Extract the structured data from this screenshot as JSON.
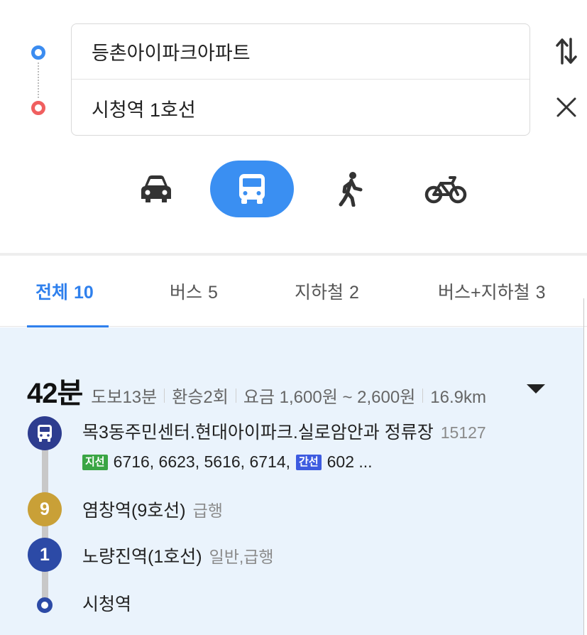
{
  "search": {
    "origin": "등촌아이파크아파트",
    "destination": "시청역 1호선"
  },
  "icons": {
    "swap": "swap-vertical-icon",
    "clear": "close-icon",
    "car": "car-icon",
    "transit": "bus-icon",
    "walk": "walk-icon",
    "bike": "bicycle-icon"
  },
  "modes": {
    "selected": "transit",
    "accent_color": "#3a8ff2"
  },
  "tabs": [
    {
      "label": "전체",
      "count": "10"
    },
    {
      "label": "버스",
      "count": "5"
    },
    {
      "label": "지하철",
      "count": "2"
    },
    {
      "label": "버스+지하철",
      "count": "3"
    }
  ],
  "result": {
    "duration": "42분",
    "walk": "도보13분",
    "transfers": "환승2회",
    "fare": "요금 1,600원 ~ 2,600원",
    "distance": "16.9km",
    "steps": [
      {
        "badge": "",
        "name": "목3동주민센터.현대아이파크.실로암안과 정류장",
        "detail": "15127"
      },
      {
        "badge": "9",
        "name": "염창역(9호선)",
        "detail": "급행"
      },
      {
        "badge": "1",
        "name": "노량진역(1호선)",
        "detail": "일반,급행"
      },
      {
        "badge": "",
        "name": "시청역",
        "detail": ""
      }
    ],
    "bus_lines": {
      "branch_label": "지선",
      "branch_routes": "6716, 6623, 5616, 6714,",
      "trunk_label": "간선",
      "trunk_routes": "602 ..."
    }
  }
}
